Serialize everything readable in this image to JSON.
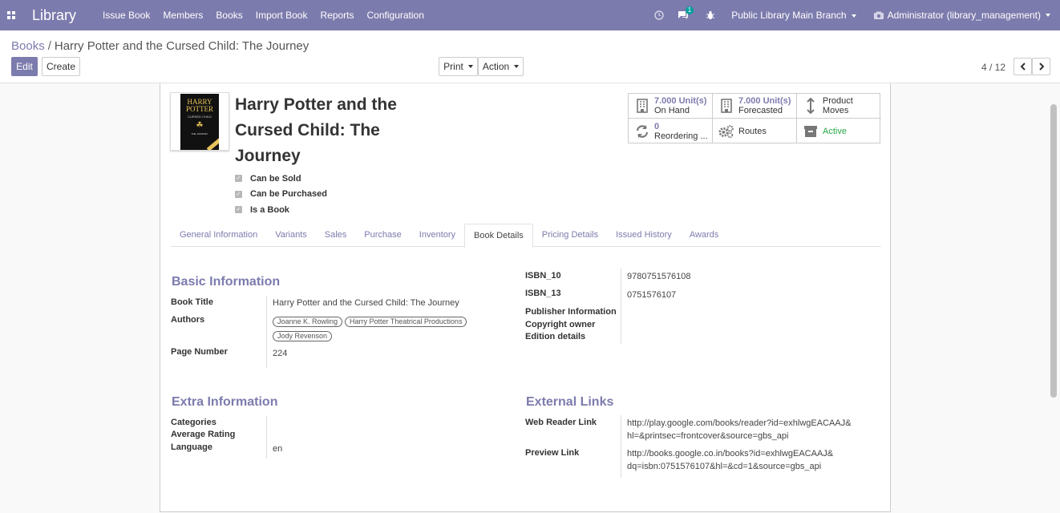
{
  "navbar": {
    "brand": "Library",
    "menu": [
      "Issue Book",
      "Members",
      "Books",
      "Import Book",
      "Reports",
      "Configuration"
    ],
    "messages_badge": "1",
    "branch": "Public Library Main Branch",
    "user": "Administrator (library_management)"
  },
  "breadcrumb": {
    "parent": "Books",
    "separator": "/",
    "current": "Harry Potter and the Cursed Child: The Journey"
  },
  "buttons": {
    "edit": "Edit",
    "create": "Create",
    "print": "Print",
    "action": "Action"
  },
  "pager": "4 / 12",
  "record": {
    "title": "Harry Potter and the Cursed Child: The Journey",
    "cover": {
      "line1": "HARRY",
      "line2": "POTTER",
      "line3": "CURSED CHILD",
      "line4": "THE JOURNEY"
    },
    "checkboxes": [
      "Can be Sold",
      "Can be Purchased",
      "Is a Book"
    ]
  },
  "smart_buttons": {
    "on_hand_value": "7.000 Unit(s)",
    "on_hand_label": "On Hand",
    "forecast_value": "7.000 Unit(s)",
    "forecast_label": "Forecasted",
    "moves_label": "Product Moves",
    "reorder_value": "0",
    "reorder_label": "Reordering ...",
    "routes_label": "Routes",
    "active_label": "Active"
  },
  "tabs": [
    "General Information",
    "Variants",
    "Sales",
    "Purchase",
    "Inventory",
    "Book Details",
    "Pricing Details",
    "Issued History",
    "Awards"
  ],
  "basic": {
    "title": "Basic Information",
    "book_title_label": "Book Title",
    "book_title": "Harry Potter and the Cursed Child: The Journey",
    "authors_label": "Authors",
    "authors": [
      "Joanne K. Rowling",
      "Harry Potter Theatrical Productions",
      "Jody Revenson"
    ],
    "page_label": "Page Number",
    "page_number": "224"
  },
  "isbn": {
    "isbn10_label": "ISBN_10",
    "isbn10": "9780751576108",
    "isbn13_label": "ISBN_13",
    "isbn13": "0751576107",
    "publisher_label": "Publisher Information",
    "copyright_label": "Copyright owner",
    "edition_label": "Edition details"
  },
  "extra": {
    "title": "Extra Information",
    "categories_label": "Categories",
    "rating_label": "Average Rating",
    "language_label": "Language",
    "language": "en"
  },
  "external": {
    "title": "External Links",
    "reader_label": "Web Reader Link",
    "reader_line1": "http://play.google.com/books/reader?id=exhlwgEACAAJ&",
    "reader_line2": "hl=&printsec=frontcover&source=gbs_api",
    "preview_label": "Preview Link",
    "preview_line1": "http://books.google.co.in/books?id=exhlwgEACAAJ&",
    "preview_line2": "dq=isbn:0751576107&hl=&cd=1&source=gbs_api"
  }
}
